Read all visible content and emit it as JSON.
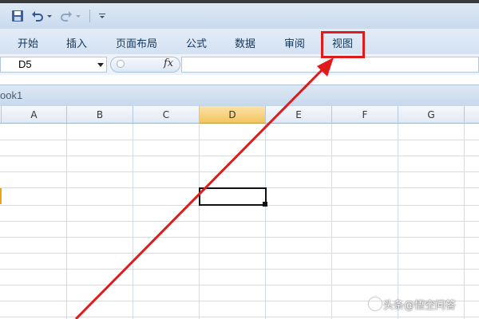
{
  "quick_access": {
    "save_icon": "save-icon",
    "undo_icon": "undo-icon",
    "redo_icon": "redo-icon",
    "customize_icon": "customize-dropdown-icon"
  },
  "ribbon": {
    "tabs": [
      "开始",
      "插入",
      "页面布局",
      "公式",
      "数据",
      "审阅",
      "视图"
    ],
    "highlighted_tab": "视图"
  },
  "formula_bar": {
    "name_box": "D5",
    "fx_label": "fx",
    "formula": ""
  },
  "workbook": {
    "title": "ook1"
  },
  "sheet": {
    "columns": [
      "A",
      "B",
      "C",
      "D",
      "E",
      "F",
      "G"
    ],
    "active_column": "D",
    "active_cell": "D5"
  },
  "annotation": {
    "color": "#e01b1b"
  },
  "watermark": {
    "text": "头条@悟空问答"
  }
}
